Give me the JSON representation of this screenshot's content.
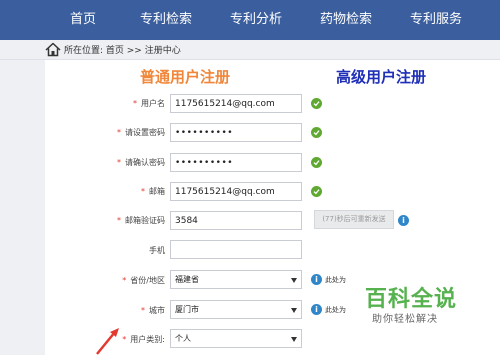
{
  "nav": {
    "items": [
      {
        "label": "首页"
      },
      {
        "label": "专利检索"
      },
      {
        "label": "专利分析"
      },
      {
        "label": "药物检索"
      },
      {
        "label": "专利服务"
      }
    ]
  },
  "breadcrumb": {
    "text": "所在位置: 首页 >> 注册中心"
  },
  "tabs": {
    "normal": "普通用户注册",
    "advanced": "高级用户注册"
  },
  "form": {
    "required_mark": "*",
    "username_label": "用户名",
    "username_value": "1175615214@qq.com",
    "password_label": "请设置密码",
    "password_value": "••••••••••",
    "confirm_label": "请确认密码",
    "confirm_value": "••••••••••",
    "email_label": "邮箱",
    "email_value": "1175615214@qq.com",
    "code_label": "邮箱验证码",
    "code_value": "3584",
    "resend_label": "(77)秒后可重新发送",
    "phone_label": "手机",
    "phone_value": "",
    "province_label": "省份/地区",
    "province_value": "福建省",
    "province_hint": "此处为",
    "city_label": "城市",
    "city_value": "厦门市",
    "city_hint": "此处为",
    "usertype_label": "用户类别:",
    "usertype_value": "个人"
  },
  "watermark": {
    "title": "百科全说",
    "subtitle": "助你轻松解决"
  },
  "colors": {
    "nav_bg": "#3b5f9e",
    "normal_tab": "#f0873a",
    "advanced_tab": "#1f2fb8",
    "check": "#5fa832",
    "info": "#2f86c9",
    "watermark": "#56b24e",
    "arrow": "#e23a2f"
  },
  "icons": {
    "home": "home-icon",
    "check": "check-icon",
    "info": "info-icon",
    "caret": "chevron-down-icon",
    "arrow": "arrow-annotation-icon"
  }
}
